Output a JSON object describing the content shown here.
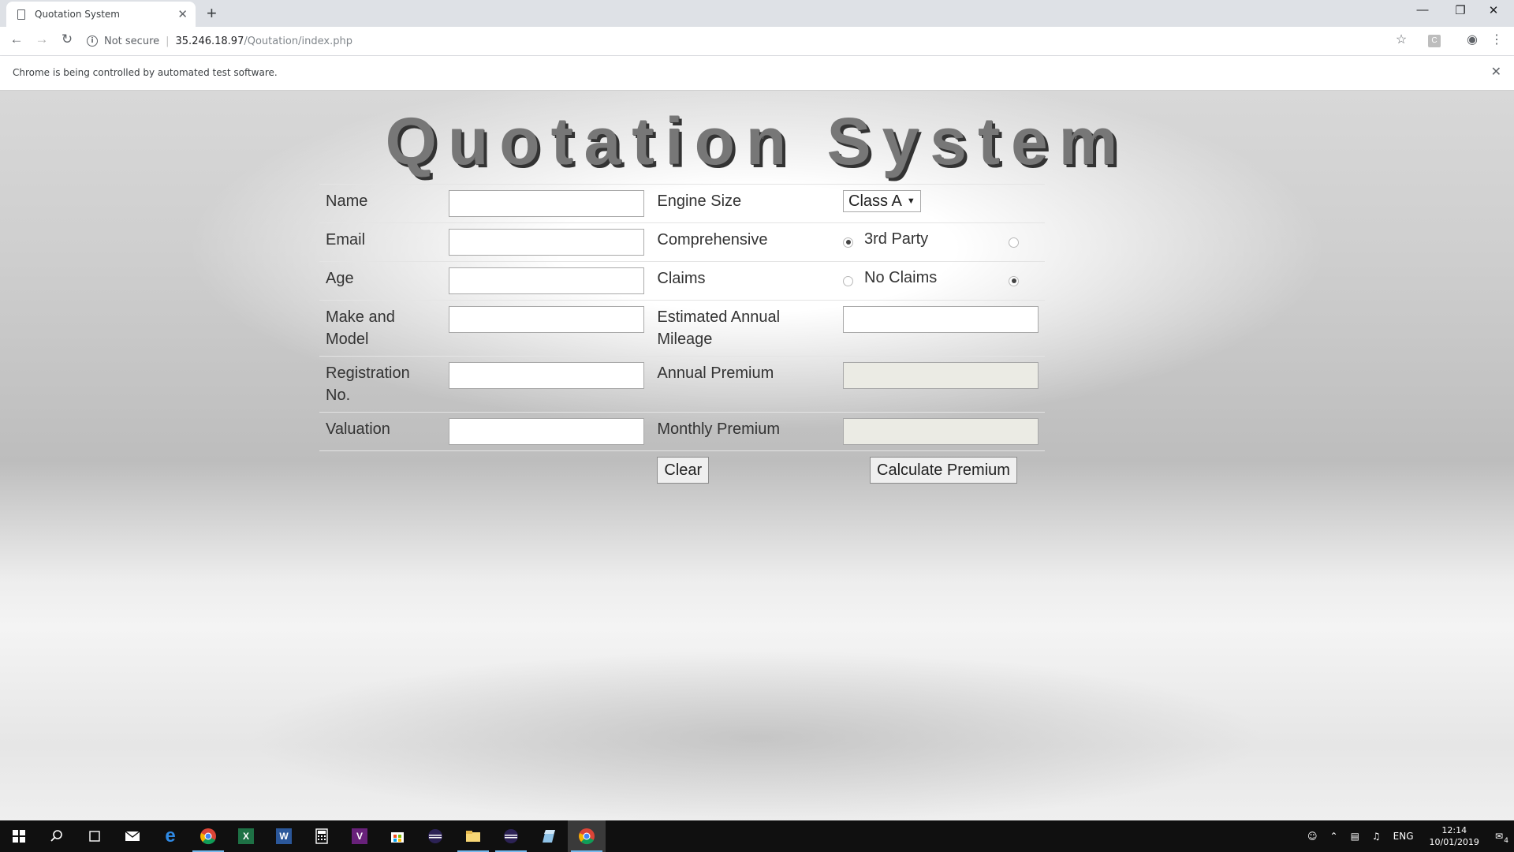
{
  "browser": {
    "tab_title": "Quotation System",
    "new_tab": "+",
    "close_tab": "✕",
    "security_label": "Not secure",
    "url_host": "35.246.18.97",
    "url_path": "/Qoutation/index.php",
    "infobar_text": "Chrome is being controlled by automated test software.",
    "ext_letter": "C"
  },
  "page": {
    "title": "Quotation System"
  },
  "form": {
    "name_label": "Name",
    "email_label": "Email",
    "age_label": "Age",
    "make_model_label": "Make and Model",
    "registration_label": "Registration No.",
    "valuation_label": "Valuation",
    "engine_size_label": "Engine Size",
    "engine_size_value": "Class A",
    "cover_label": "Comprehensive",
    "third_party_label": "3rd Party",
    "claims_label": "Claims",
    "no_claims_label": "No Claims",
    "mileage_label": "Estimated Annual Mileage",
    "annual_premium_label": "Annual Premium",
    "monthly_premium_label": "Monthly Premium",
    "name_value": "",
    "email_value": "",
    "age_value": "",
    "make_model_value": "",
    "registration_value": "",
    "valuation_value": "",
    "mileage_value": "",
    "annual_premium_value": "",
    "monthly_premium_value": "",
    "clear_button": "Clear",
    "calculate_button": "Calculate Premium"
  },
  "taskbar": {
    "language": "ENG",
    "time": "12:14",
    "date": "10/01/2019",
    "notification_count": "4"
  }
}
